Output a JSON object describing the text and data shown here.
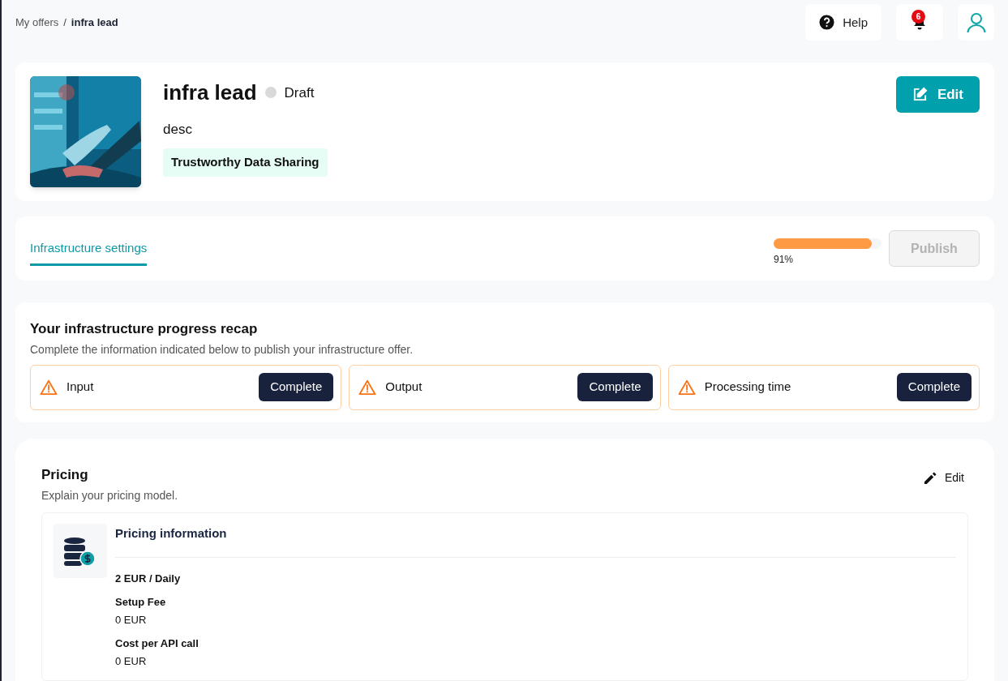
{
  "breadcrumb": [
    {
      "label": "My offers",
      "current": false
    },
    {
      "label": "infra lead",
      "current": true
    }
  ],
  "separator": "/",
  "topbar": {
    "help": "Help",
    "notifications": "6"
  },
  "offer": {
    "title": "infra lead",
    "status": "Draft",
    "description": "desc",
    "tag": "Trustworthy Data Sharing",
    "edit": "Edit"
  },
  "tabs": [
    {
      "label": "Infrastructure settings",
      "selected": true
    }
  ],
  "progress": {
    "level": 0.91,
    "reading": "91%"
  },
  "publish": {
    "label": "Publish",
    "disabled": true
  },
  "recap": {
    "title": "Your infrastructure progress recap",
    "subtitle": "Complete the information indicated below to publish your infrastructure offer.",
    "items": [
      {
        "label": "Input",
        "action": "Complete"
      },
      {
        "label": "Output",
        "action": "Complete"
      },
      {
        "label": "Processing time",
        "action": "Complete"
      }
    ]
  },
  "pricing": {
    "title": "Pricing",
    "subtitle": "Explain your pricing model.",
    "edit": "Edit",
    "info_title": "Pricing information",
    "price": "2 EUR / Daily",
    "fields": [
      {
        "label": "Setup Fee",
        "value": "0 EUR"
      },
      {
        "label": "Cost per API call",
        "value": "0 EUR"
      }
    ]
  }
}
